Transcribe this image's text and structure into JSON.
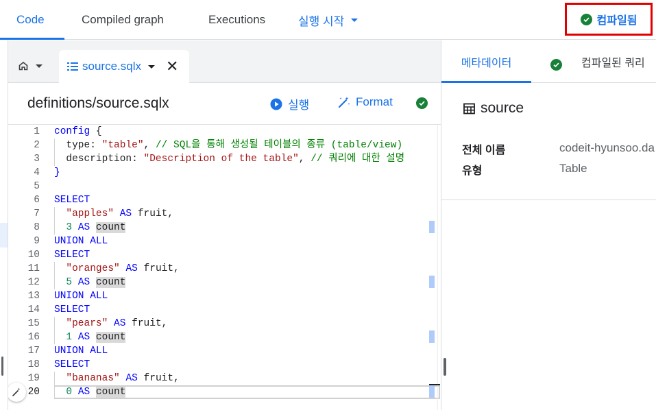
{
  "top_tabs": {
    "code": "Code",
    "compiled_graph": "Compiled graph",
    "executions": "Executions",
    "run": "실행 시작"
  },
  "compiled_status": "컴파일됨",
  "editor_tab": {
    "filename": "source.sqlx"
  },
  "editor": {
    "path": "definitions/source.sqlx",
    "run_label": "실행",
    "format_label": "Format"
  },
  "code": {
    "line_numbers": [
      "1",
      "2",
      "3",
      "4",
      "5",
      "6",
      "7",
      "8",
      "9",
      "10",
      "11",
      "12",
      "13",
      "14",
      "15",
      "16",
      "17",
      "18",
      "19",
      "20"
    ],
    "lines": {
      "l1": {
        "kw": "config",
        "brace": " {"
      },
      "l2": {
        "key": "  type: ",
        "str": "\"table\"",
        "sep": ", ",
        "comment": "// SQL을 통해 생성될 테이블의 종류 (table/view)"
      },
      "l3": {
        "key": "  description: ",
        "str": "\"Description of the table\"",
        "sep": ", ",
        "comment": "// 쿼리에 대한 설명"
      },
      "l4": {
        "brace": "}"
      },
      "l6": {
        "kw": "SELECT"
      },
      "l7": {
        "str": "\"apples\"",
        "as": "AS",
        "rest": " fruit,"
      },
      "l8": {
        "num": "3",
        "as": "AS",
        "count": "count"
      },
      "l9": {
        "kw": "UNION ALL"
      },
      "l10": {
        "kw": "SELECT"
      },
      "l11": {
        "str": "\"oranges\"",
        "as": "AS",
        "rest": " fruit,"
      },
      "l12": {
        "num": "5",
        "as": "AS",
        "count": "count"
      },
      "l13": {
        "kw": "UNION ALL"
      },
      "l14": {
        "kw": "SELECT"
      },
      "l15": {
        "str": "\"pears\"",
        "as": "AS",
        "rest": " fruit,"
      },
      "l16": {
        "num": "1",
        "as": "AS",
        "count": "count"
      },
      "l17": {
        "kw": "UNION ALL"
      },
      "l18": {
        "kw": "SELECT"
      },
      "l19": {
        "str": "\"bananas\"",
        "as": "AS",
        "rest": " fruit,"
      },
      "l20": {
        "num": "0",
        "as": "AS",
        "count": "count"
      }
    },
    "current_line": "20"
  },
  "right_panel": {
    "tab_metadata": "메타데이터",
    "tab_compiled_query": "컴파일된 쿼리",
    "title": "source",
    "full_name_label": "전체 이름",
    "full_name_value": "codeit-hyunsoo.da",
    "type_label": "유형",
    "type_value": "Table"
  },
  "colors": {
    "accent": "#1a73e8",
    "success": "#188038",
    "highlight_border": "#e00000",
    "keyword": "#0000ff",
    "string": "#a31515",
    "comment": "#008000",
    "number": "#098658"
  },
  "icons": [
    "check-circle-icon",
    "home-icon",
    "file-lines-icon",
    "close-icon",
    "play-circle-icon",
    "magic-wand-icon",
    "table-icon",
    "chevron-down-icon"
  ]
}
